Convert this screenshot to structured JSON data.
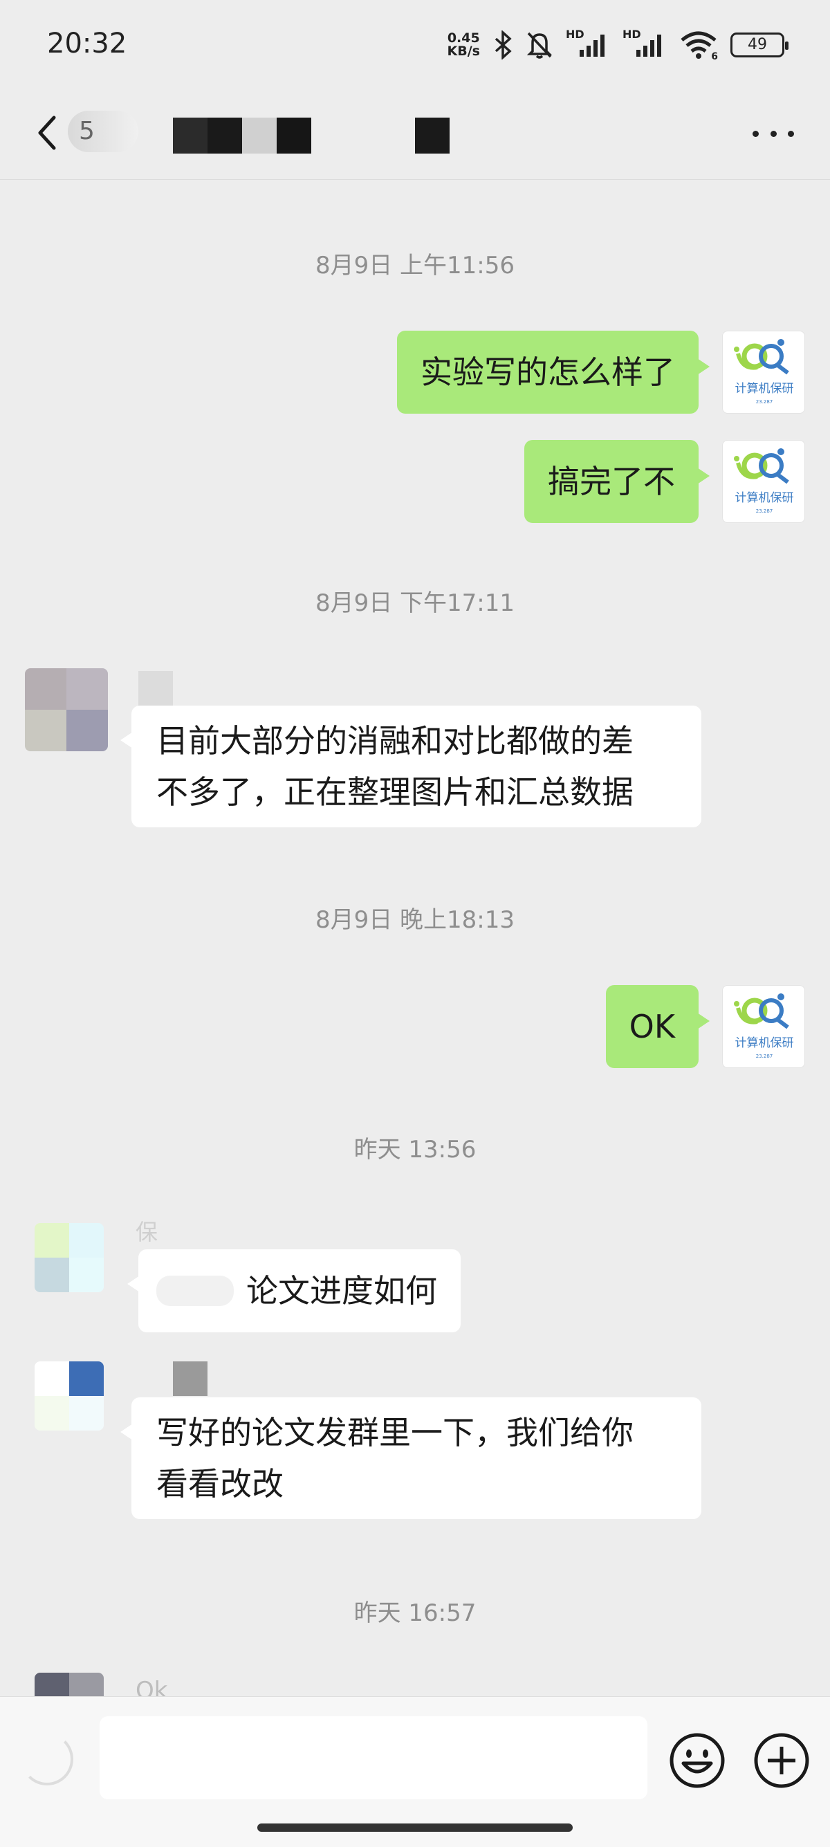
{
  "status_bar": {
    "time": "20:32",
    "net_speed_value": "0.45",
    "net_speed_unit": "KB/s",
    "signal1_label": "HD",
    "signal2_label": "HD",
    "wifi_label": "6",
    "battery": "49"
  },
  "header": {
    "title_visible": "5"
  },
  "messages": [
    {
      "type": "timestamp",
      "text": "8月9日 上午11:56"
    },
    {
      "type": "mine",
      "text": "实验写的怎么样了"
    },
    {
      "type": "mine",
      "text": "搞完了不"
    },
    {
      "type": "timestamp",
      "text": "8月9日 下午17:11"
    },
    {
      "type": "theirs",
      "text_line1": "目前大部分的消融和对比都做的差",
      "text_line2": "不多了，正在整理图片和汇总数据"
    },
    {
      "type": "timestamp",
      "text": "8月9日 晚上18:13"
    },
    {
      "type": "mine",
      "text": "OK"
    },
    {
      "type": "timestamp",
      "text": "昨天 13:56"
    },
    {
      "type": "theirs",
      "sender": "保",
      "text": "论文进度如何"
    },
    {
      "type": "theirs",
      "text_line1": "写好的论文发群里一下，我们给你",
      "text_line2": "看看改改"
    },
    {
      "type": "timestamp",
      "text": "昨天 16:57"
    },
    {
      "type": "theirs",
      "text": "Ok"
    }
  ],
  "my_avatar": {
    "caption": "计算机保研",
    "sub_caption": "23.287",
    "accent_green": "#9dd64a",
    "accent_blue": "#3b7cc4"
  },
  "input": {
    "value": "",
    "placeholder": ""
  },
  "colors": {
    "background": "#ededed",
    "my_bubble": "#a9e97a",
    "their_bubble": "#ffffff"
  }
}
